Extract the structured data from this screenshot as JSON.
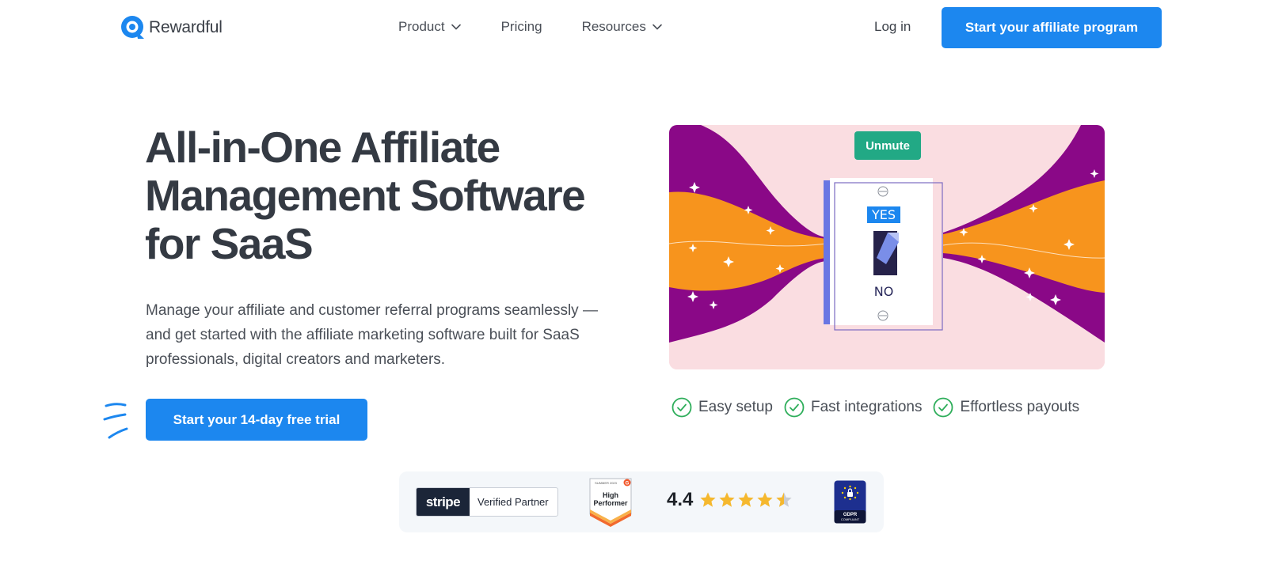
{
  "nav": {
    "brand": "Rewardful",
    "links": [
      {
        "label": "Product",
        "has_dropdown": true
      },
      {
        "label": "Pricing",
        "has_dropdown": false
      },
      {
        "label": "Resources",
        "has_dropdown": true
      }
    ],
    "login": "Log in",
    "cta": "Start your affiliate program"
  },
  "hero": {
    "headline": "All-in-One Affiliate Management Software for SaaS",
    "subtext": "Manage your affiliate and customer referral programs seamlessly — and get started with the affiliate marketing software built for SaaS professionals, digital creators and marketers.",
    "cta": "Start your 14-day free trial",
    "video": {
      "unmute": "Unmute",
      "switch_yes": "YES",
      "switch_no": "NO"
    },
    "features": [
      "Easy setup",
      "Fast integrations",
      "Effortless payouts"
    ]
  },
  "badges": {
    "stripe_word": "stripe",
    "stripe_label": "Verified Partner",
    "g2_season": "SUMMER 2023",
    "g2_title_1": "High",
    "g2_title_2": "Performer",
    "rating": "4.4",
    "rating_value": 4.4,
    "rating_max": 5,
    "gdpr_1": "GDPR",
    "gdpr_2": "COMPLIANT"
  },
  "colors": {
    "brand_blue": "#1c87ef",
    "check_green": "#2fae5b",
    "unmute_green": "#22a985",
    "purple": "#8a0887",
    "orange": "#f7941d",
    "star_yellow": "#f5b82e"
  },
  "icons": [
    "logo-icon",
    "chevron-down-icon",
    "check-circle-icon",
    "star-icon",
    "g2-badge-icon",
    "gdpr-badge-icon"
  ]
}
